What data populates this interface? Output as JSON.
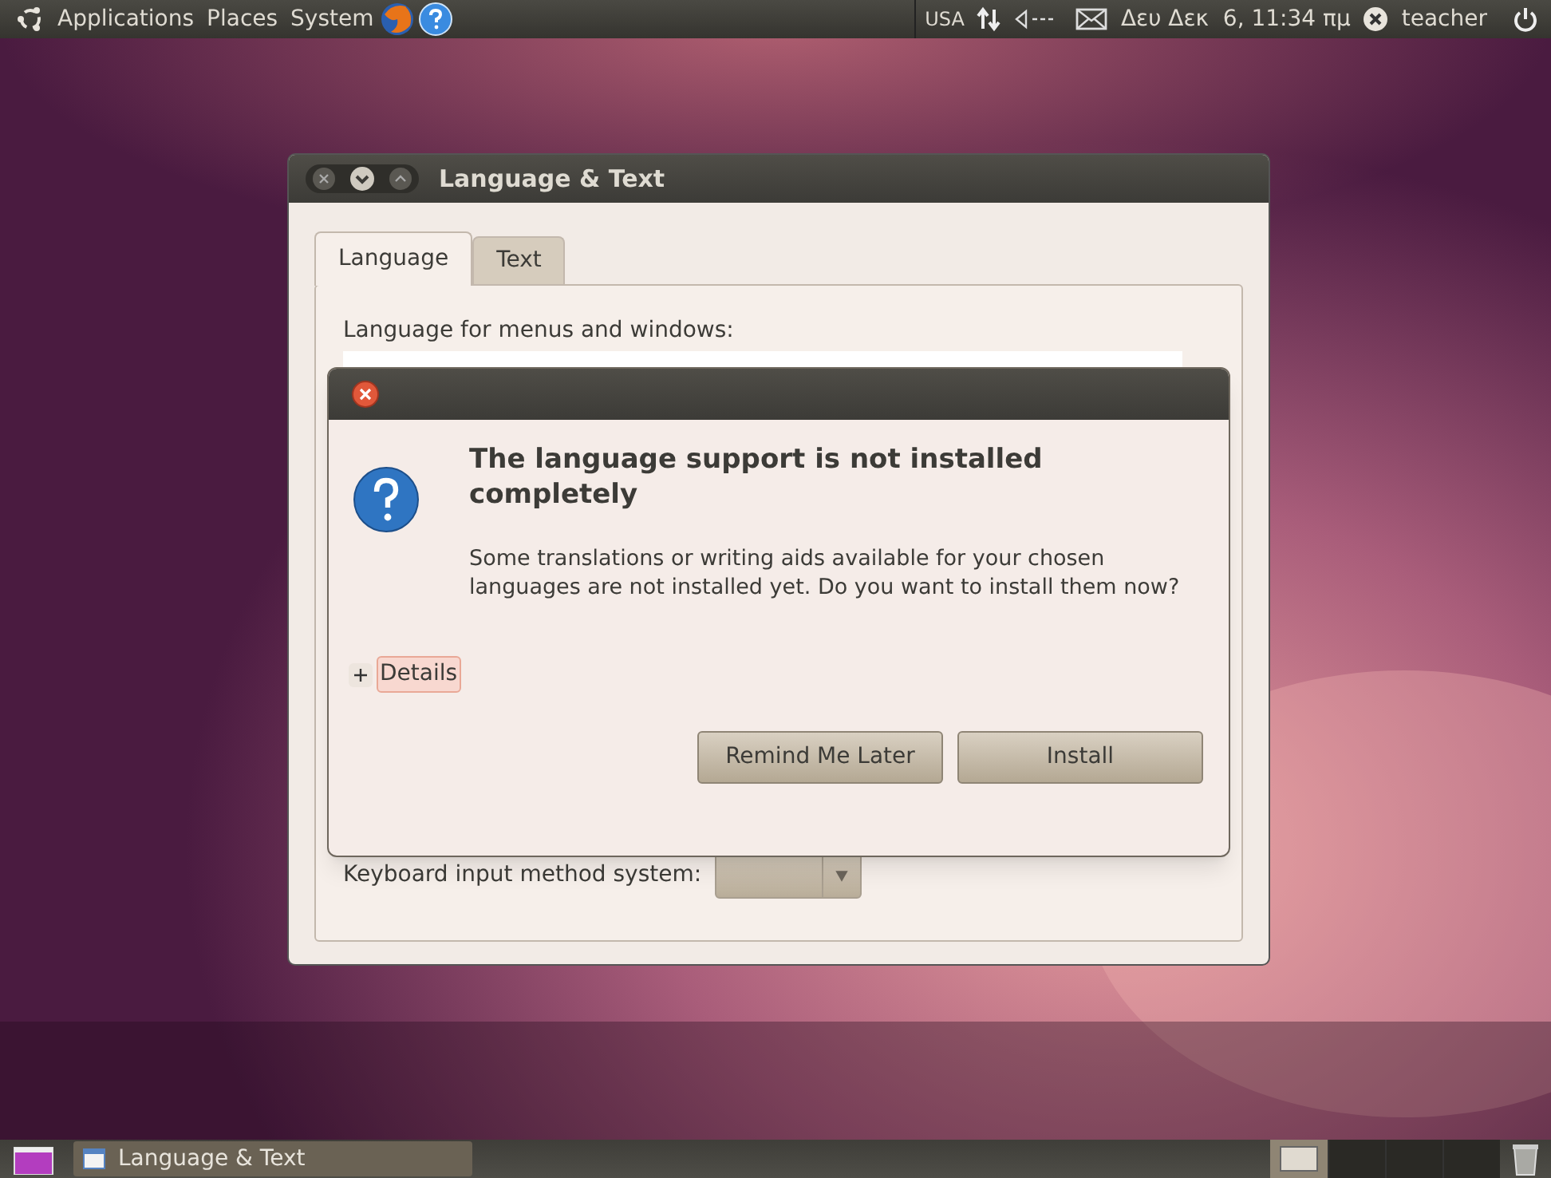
{
  "top_panel": {
    "menus": [
      "Applications",
      "Places",
      "System"
    ],
    "keyboard_layout": "USA",
    "clock": "Δευ Δεκ  6, 11:34 πμ",
    "user": "teacher"
  },
  "window": {
    "title": "Language & Text",
    "tabs": [
      {
        "label": "Language",
        "selected": true
      },
      {
        "label": "Text",
        "selected": false
      }
    ],
    "list_label": "Language for menus and windows:",
    "keyboard_label": "Keyboard input method system:"
  },
  "dialog": {
    "title": "The language support is not installed completely",
    "message": "Some translations or writing aids available for your chosen languages are not installed yet. Do you want to install them now?",
    "details": {
      "label": "Details",
      "expanded": false
    },
    "buttons": [
      "Remind Me Later",
      "Install"
    ]
  },
  "taskbar": {
    "tasks": [
      {
        "label": "Language & Text",
        "selected": true
      }
    ]
  }
}
